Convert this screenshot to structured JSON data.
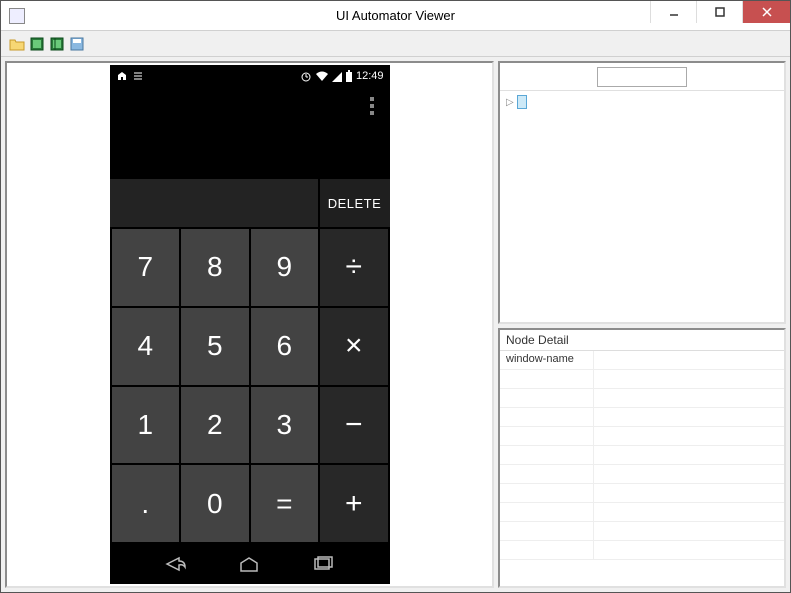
{
  "window": {
    "title": "UI Automator Viewer"
  },
  "phone": {
    "status": {
      "time": "12:49"
    },
    "delete_label": "DELETE",
    "keys": [
      {
        "label": "7",
        "type": "num"
      },
      {
        "label": "8",
        "type": "num"
      },
      {
        "label": "9",
        "type": "num"
      },
      {
        "label": "÷",
        "type": "op"
      },
      {
        "label": "4",
        "type": "num"
      },
      {
        "label": "5",
        "type": "num"
      },
      {
        "label": "6",
        "type": "num"
      },
      {
        "label": "×",
        "type": "op"
      },
      {
        "label": "1",
        "type": "num"
      },
      {
        "label": "2",
        "type": "num"
      },
      {
        "label": "3",
        "type": "num"
      },
      {
        "label": "−",
        "type": "op"
      },
      {
        "label": ".",
        "type": "num"
      },
      {
        "label": "0",
        "type": "num"
      },
      {
        "label": "=",
        "type": "num"
      },
      {
        "label": "+",
        "type": "op"
      }
    ]
  },
  "detail": {
    "section_title": "Node Detail",
    "rows": [
      {
        "k": "window-name",
        "v": ""
      },
      {
        "k": "",
        "v": ""
      },
      {
        "k": "",
        "v": ""
      },
      {
        "k": "",
        "v": ""
      },
      {
        "k": "",
        "v": ""
      },
      {
        "k": "",
        "v": ""
      },
      {
        "k": "",
        "v": ""
      },
      {
        "k": "",
        "v": ""
      },
      {
        "k": "",
        "v": ""
      },
      {
        "k": "",
        "v": ""
      },
      {
        "k": "",
        "v": ""
      }
    ]
  }
}
